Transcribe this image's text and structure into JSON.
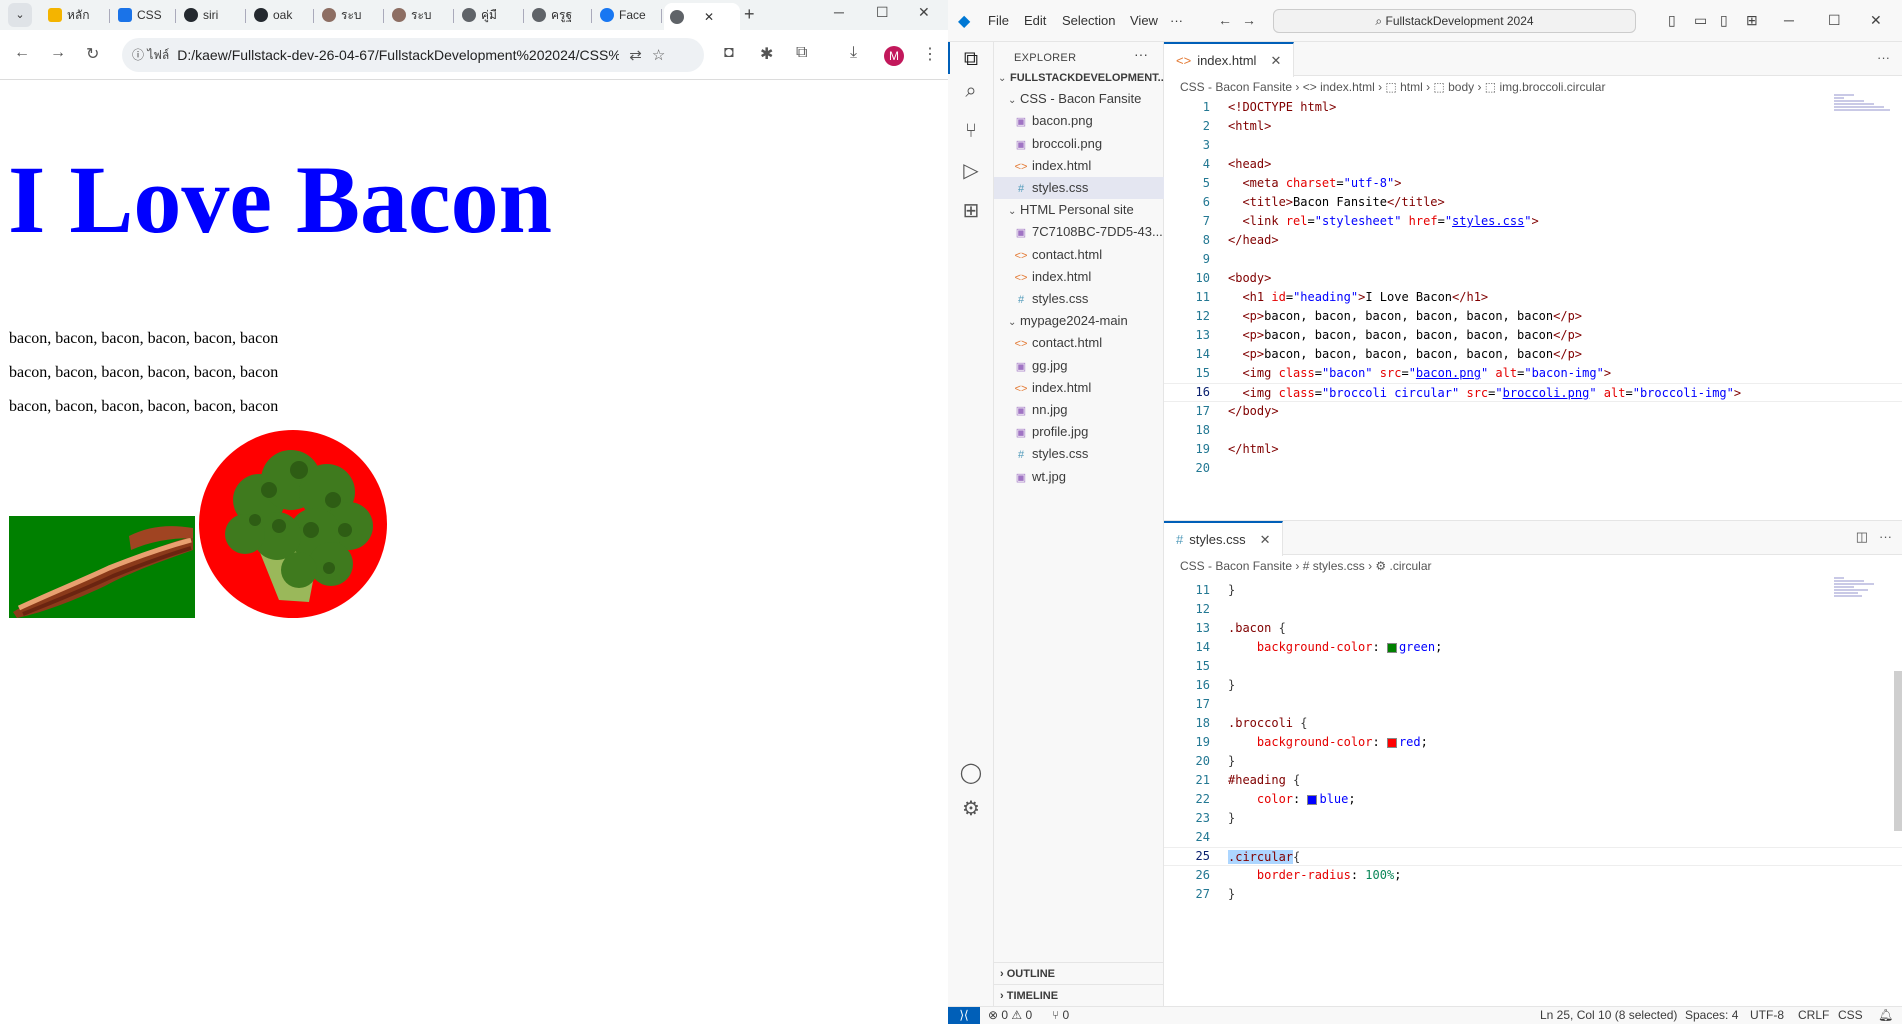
{
  "chrome": {
    "tabs": [
      {
        "label": "หลัก",
        "color": "#f4b400"
      },
      {
        "label": "CSS",
        "color": "#1a73e8"
      },
      {
        "label": "siri",
        "color": "#24292f"
      },
      {
        "label": "oak",
        "color": "#24292f"
      },
      {
        "label": "ระบ",
        "color": "#8d6e63"
      },
      {
        "label": "ระบ",
        "color": "#8d6e63"
      },
      {
        "label": "คู่มื",
        "color": "#5f6368"
      },
      {
        "label": "ครูฐ",
        "color": "#5f6368"
      },
      {
        "label": "Face",
        "color": "#1877f2"
      },
      {
        "label": "",
        "color": "#5f6368"
      }
    ],
    "info_label": "ไฟล์",
    "url": "D:/kaew/Fullstack-dev-26-04-67/FullstackDevelopment%202024/CSS%...",
    "profile_initial": "M"
  },
  "page": {
    "heading": "I Love Bacon",
    "paragraphs": [
      "bacon, bacon, bacon, bacon, bacon, bacon",
      "bacon, bacon, bacon, bacon, bacon, bacon",
      "bacon, bacon, bacon, bacon, bacon, bacon"
    ]
  },
  "vscode": {
    "menu": [
      "File",
      "Edit",
      "Selection",
      "View",
      "···"
    ],
    "command_center": "FullstackDevelopment 2024",
    "explorer_title": "EXPLORER",
    "tree": [
      {
        "label": "FULLSTACKDEVELOPMENT...",
        "type": "root"
      },
      {
        "label": "CSS - Bacon Fansite",
        "type": "folder"
      },
      {
        "label": "bacon.png",
        "type": "img"
      },
      {
        "label": "broccoli.png",
        "type": "img"
      },
      {
        "label": "index.html",
        "type": "html"
      },
      {
        "label": "styles.css",
        "type": "css",
        "selected": true
      },
      {
        "label": "HTML Personal site",
        "type": "folder"
      },
      {
        "label": "7C7108BC-7DD5-43...",
        "type": "img"
      },
      {
        "label": "contact.html",
        "type": "html"
      },
      {
        "label": "index.html",
        "type": "html"
      },
      {
        "label": "styles.css",
        "type": "css"
      },
      {
        "label": "mypage2024-main",
        "type": "folder"
      },
      {
        "label": "contact.html",
        "type": "html"
      },
      {
        "label": "gg.jpg",
        "type": "img"
      },
      {
        "label": "index.html",
        "type": "html"
      },
      {
        "label": "nn.jpg",
        "type": "img"
      },
      {
        "label": "profile.jpg",
        "type": "img"
      },
      {
        "label": "styles.css",
        "type": "css"
      },
      {
        "label": "wt.jpg",
        "type": "img"
      }
    ],
    "outline_label": "OUTLINE",
    "timeline_label": "TIMELINE",
    "html_editor": {
      "tab": "index.html",
      "breadcrumb": "CSS - Bacon Fansite  ›  <> index.html  ›  ⬚ html  ›  ⬚ body  ›  ⬚ img.broccoli.circular",
      "line_numbers": [
        "1",
        "2",
        "3",
        "4",
        "5",
        "6",
        "7",
        "8",
        "9",
        "10",
        "11",
        "12",
        "13",
        "14",
        "15",
        "16",
        "17",
        "18",
        "19",
        "20"
      ],
      "current_line": "16"
    },
    "css_editor": {
      "tab": "styles.css",
      "breadcrumb": "CSS - Bacon Fansite  ›  # styles.css  ›  ⚙ .circular",
      "line_numbers": [
        "11",
        "12",
        "13",
        "14",
        "15",
        "16",
        "17",
        "18",
        "19",
        "20",
        "21",
        "22",
        "23",
        "24",
        "25",
        "26",
        "27"
      ],
      "current_line": "25"
    },
    "status": {
      "errors": "0",
      "warnings": "0",
      "ports": "0",
      "position": "Ln 25, Col 10 (8 selected)",
      "spaces": "Spaces: 4",
      "encoding": "UTF-8",
      "eol": "CRLF",
      "language": "CSS"
    }
  }
}
